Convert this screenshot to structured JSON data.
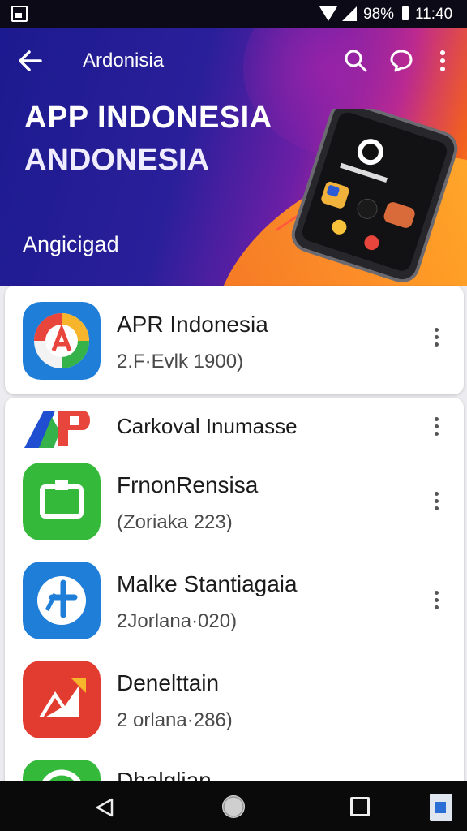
{
  "status_bar": {
    "battery": "98%",
    "time": "11:40"
  },
  "header": {
    "title": "Ardonisia",
    "hero_title_line1": "APP INDONESIA",
    "hero_title_line2": "ANDONESIA",
    "hero_subtitle": "Angicigad"
  },
  "featured": {
    "name": "APR Indonesia",
    "meta": "2.F·Evlk 1900)"
  },
  "list": {
    "items": [
      {
        "name": "Carkoval Inumasse",
        "meta": ""
      },
      {
        "name": "FrnonRensisa",
        "meta": "(Zoriaka 223)"
      },
      {
        "name": "Malke Stantiagaia",
        "meta": "2Jorlana·020)"
      },
      {
        "name": "Denelttain",
        "meta": "2 orlana·286)"
      },
      {
        "name": "Dhalglian",
        "meta": ""
      }
    ]
  },
  "icons": {
    "back": "arrow-left-icon",
    "search": "search-icon",
    "chat": "chat-bubble-icon",
    "more": "more-vertical-icon"
  },
  "colors": {
    "hero_gradient_start": "#1c1a8f",
    "hero_gradient_end": "#ff8a1a",
    "icon_green": "#34b93a",
    "icon_blue": "#1f7fd8",
    "icon_red": "#e23b2f"
  }
}
